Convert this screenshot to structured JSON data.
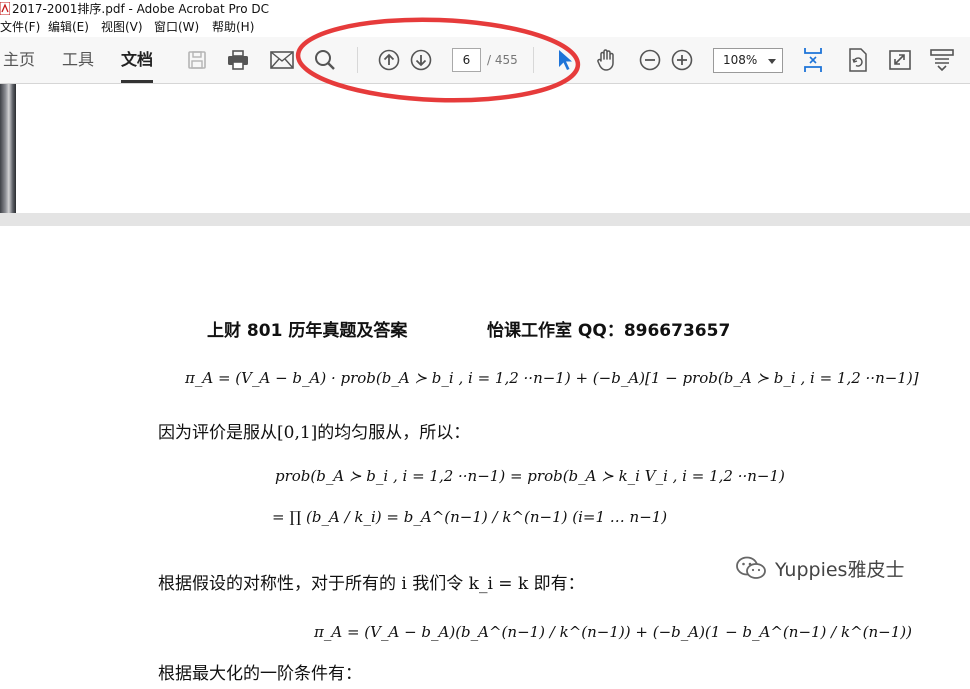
{
  "window": {
    "title": "2017-2001排序.pdf - Adobe Acrobat Pro DC"
  },
  "menu": [
    "文件(F)",
    "编辑(E)",
    "视图(V)",
    "窗口(W)",
    "帮助(H)"
  ],
  "tabs": {
    "home": "主页",
    "tools": "工具",
    "document": "文档"
  },
  "navigation": {
    "current_page": "6",
    "total_pages": "/ 455"
  },
  "zoom": {
    "value": "108%"
  },
  "annotation": {
    "ellipse_color": "#e63b3b"
  },
  "accent_color": "#1e74d8",
  "document": {
    "header_left": "上财 801 历年真题及答案",
    "header_right": "怡课工作室 QQ：896673657",
    "eq1": "π_A = (V_A − b_A) · prob(b_A ≻ b_i , i = 1,2 ··n−1) + (−b_A)[1 − prob(b_A ≻ b_i , i = 1,2 ··n−1)]",
    "text1": "因为评价是服从[0,1]的均匀服从，所以：",
    "eq2": "prob(b_A ≻ b_i , i = 1,2 ··n−1) = prob(b_A ≻ k_i V_i , i = 1,2 ··n−1)",
    "eq3": "= ∏ (b_A / k_i) = b_A^(n−1) / k^(n−1)   (i=1 … n−1)",
    "text2": "根据假设的对称性，对于所有的 i 我们令 k_i = k 即有：",
    "eq4": "π_A = (V_A − b_A)(b_A^(n−1) / k^(n−1)) + (−b_A)(1 − b_A^(n−1) / k^(n−1))",
    "text3": "根据最大化的一阶条件有："
  },
  "watermark": {
    "text": "Yuppies雅皮士"
  }
}
